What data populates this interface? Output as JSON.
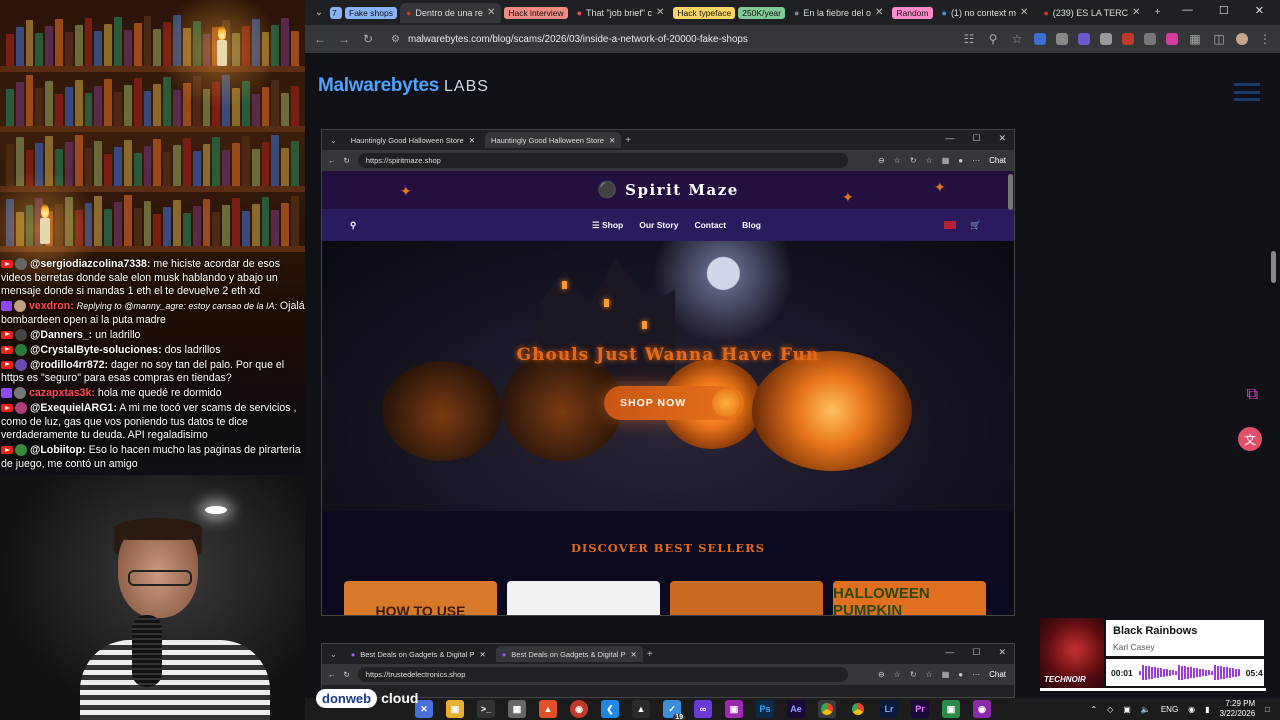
{
  "chat": {
    "messages": [
      {
        "platform": "youtube",
        "user": "@sergiodiazcolina7338:",
        "text": "me hiciste acordar de esos videos berretas donde sale elon musk hablando y abajo un mensaje donde si mandas 1 eth el te devuelve 2 eth xd",
        "reply": ""
      },
      {
        "platform": "twitch",
        "user": "vexdron:",
        "text": "Ojalá bombardeen open ai la puta madre",
        "reply": "Replying to @manny_agre: estoy cansao de la IA:"
      },
      {
        "platform": "youtube",
        "user": "@Danners_:",
        "text": "un ladrillo",
        "reply": ""
      },
      {
        "platform": "youtube",
        "user": "@CrystalByte-soluciones:",
        "text": "dos ladrillos",
        "reply": ""
      },
      {
        "platform": "youtube",
        "user": "@rodillo4rr872:",
        "text": "dager no soy tan del palo. Por que el https es \"seguro\" para esas compras en tiendas?",
        "reply": ""
      },
      {
        "platform": "twitch",
        "user": "cazapxtas3k:",
        "text": "hola me quedé re dormido",
        "reply": ""
      },
      {
        "platform": "youtube",
        "user": "@ExequielARG1:",
        "text": "A mi me tocó ver scams de servicios , como de luz, gas que vos poniendo tus datos te dice verdaderamente tu deuda. API regaladisimo",
        "reply": ""
      },
      {
        "platform": "youtube",
        "user": "@Lobiitop:",
        "text": "Eso lo hacen mucho las paginas de pirarteria de juego, me contó un amigo",
        "reply": ""
      }
    ]
  },
  "sponsor": {
    "brand": "donweb",
    "suffix": "cloud"
  },
  "browser": {
    "tabs": [
      {
        "label": "Fake shops",
        "type": "group",
        "color": "#8ab4f8"
      },
      {
        "label": "Dentro de una re",
        "type": "tab",
        "active": true
      },
      {
        "label": "Hack interview",
        "type": "group",
        "color": "#f28b82"
      },
      {
        "label": "That \"job brief\" c",
        "type": "tab",
        "active": false
      },
      {
        "label": "Hack typeface",
        "type": "group",
        "color": "#fdd663"
      },
      {
        "label": "250K/year",
        "type": "group",
        "color": "#81c995"
      },
      {
        "label": "En la fiebre del o",
        "type": "tab",
        "active": false
      },
      {
        "label": "Random",
        "type": "group",
        "color": "#ff8bcb"
      },
      {
        "label": "(1) no context m",
        "type": "tab",
        "active": false
      },
      {
        "label": "(239) ES LA TERC",
        "type": "tab",
        "active": false
      }
    ],
    "url": "malwarebytes.com/blog/scams/2026/03/inside-a-network-of-20000-fake-shops"
  },
  "page": {
    "logo_main": "Malwarebytes",
    "logo_sub": "LABS"
  },
  "shot1": {
    "tabs": [
      "Hauntingly Good Halloween Store",
      "Hauntingly Good Halloween Store"
    ],
    "url": "https://spiritmaze.shop",
    "chat_label": "Chat",
    "site": {
      "brand": "Spirit Maze",
      "nav": [
        "Shop",
        "Our Story",
        "Contact",
        "Blog"
      ],
      "hero_title": "Ghouls Just Wanna Have Fun",
      "cta": "SHOP NOW",
      "section_title": "DISCOVER BEST SELLERS",
      "cards": [
        "HOW TO USE",
        "",
        "",
        "HALLOWEEN PUMPKIN"
      ]
    }
  },
  "shot2": {
    "tabs": [
      "Best Deals on Gadgets & Digital P",
      "Best Deals on Gadgets & Digital P"
    ],
    "url": "https://trustedelectronics.shop",
    "chat_label": "Chat"
  },
  "now_playing": {
    "title": "Black Rainbows",
    "artist": "Karl Casey",
    "elapsed": "00:01",
    "duration": "05:4",
    "progress": 0.003,
    "art_label": "TECHNOIR"
  },
  "tray": {
    "lang": "ENG",
    "time": "7:29 PM",
    "date": "3/22/2026",
    "taskbar_badge": "19"
  }
}
